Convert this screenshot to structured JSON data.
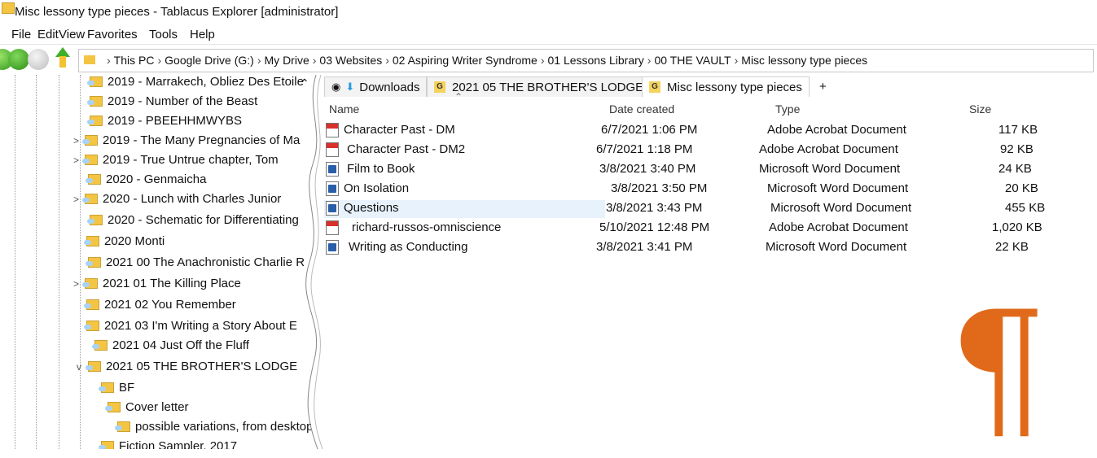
{
  "window": {
    "title": "Misc lessony type pieces - Tablacus Explorer [administrator]"
  },
  "menu": [
    "File",
    "Edit",
    "View",
    "Favorites",
    "Tools",
    "Help"
  ],
  "address": {
    "crumbs": [
      "This PC",
      "Google Drive (G:)",
      "My Drive",
      "03 Websites",
      "02 Aspiring Writer Syndrome",
      "01 Lessons Library",
      "00 THE VAULT",
      "Misc lessony type pieces"
    ]
  },
  "tree": {
    "items": [
      {
        "label": "2019 - Marrakech, Obliez Des Etoile",
        "expander": ""
      },
      {
        "label": "2019 - Number of the Beast",
        "expander": ""
      },
      {
        "label": "2019 - PBEEHHMWYBS",
        "expander": ""
      },
      {
        "label": "2019 - The Many Pregnancies of Ma",
        "expander": ">"
      },
      {
        "label": "2019 - True Untrue chapter, Tom",
        "expander": ">"
      },
      {
        "label": "2020 - Genmaicha",
        "expander": ""
      },
      {
        "label": "2020 - Lunch with Charles Junior",
        "expander": ">"
      },
      {
        "label": "2020 - Schematic for Differentiating",
        "expander": ""
      },
      {
        "label": "2020 Monti",
        "expander": ""
      },
      {
        "label": "2021 00 The Anachronistic Charlie R",
        "expander": ""
      },
      {
        "label": "2021 01 The Killing Place",
        "expander": ">"
      },
      {
        "label": "2021 02 You Remember",
        "expander": ""
      },
      {
        "label": "2021 03 I'm Writing a Story About E",
        "expander": ""
      },
      {
        "label": "2021 04 Just Off the Fluff",
        "expander": ""
      },
      {
        "label": "2021 05 THE BROTHER'S LODGE",
        "expander": "v"
      },
      {
        "label": "BF",
        "expander": ""
      },
      {
        "label": "Cover letter",
        "expander": ""
      },
      {
        "label": "possible variations, from desktop",
        "expander": ""
      },
      {
        "label": "Fiction Sampler, 2017",
        "expander": ""
      }
    ]
  },
  "tabs": [
    {
      "label": "Downloads"
    },
    {
      "label": "2021 05 THE BROTHER'S LODGE"
    },
    {
      "label": "Misc lessony type pieces"
    },
    {
      "label": "+"
    }
  ],
  "columns": {
    "name": "Name",
    "date": "Date created",
    "type": "Type",
    "size": "Size"
  },
  "files": [
    {
      "name": "Character Past - DM",
      "date": "6/7/2021 1:06 PM",
      "type": "Adobe Acrobat Document",
      "size": "117 KB",
      "kind": "pdf"
    },
    {
      "name": "Character Past - DM2",
      "date": "6/7/2021 1:18 PM",
      "type": "Adobe Acrobat Document",
      "size": "92 KB",
      "kind": "pdf"
    },
    {
      "name": "Film to Book",
      "date": "3/8/2021 3:40 PM",
      "type": "Microsoft Word Document",
      "size": "24 KB",
      "kind": "doc"
    },
    {
      "name": "On Isolation",
      "date": "3/8/2021 3:50 PM",
      "type": "Microsoft Word Document",
      "size": "20 KB",
      "kind": "doc"
    },
    {
      "name": "Questions",
      "date": "3/8/2021 3:43 PM",
      "type": "Microsoft Word Document",
      "size": "455 KB",
      "kind": "doc"
    },
    {
      "name": "richard-russos-omniscience",
      "date": "5/10/2021 12:48 PM",
      "type": "Adobe Acrobat Document",
      "size": "1,020 KB",
      "kind": "pdf"
    },
    {
      "name": "Writing as Conducting",
      "date": "3/8/2021 3:41 PM",
      "type": "Microsoft Word Document",
      "size": "22 KB",
      "kind": "doc"
    }
  ],
  "selected_file": "Questions",
  "decoration": {
    "glyph": "¶",
    "glyph_color": "#e06a1a"
  }
}
